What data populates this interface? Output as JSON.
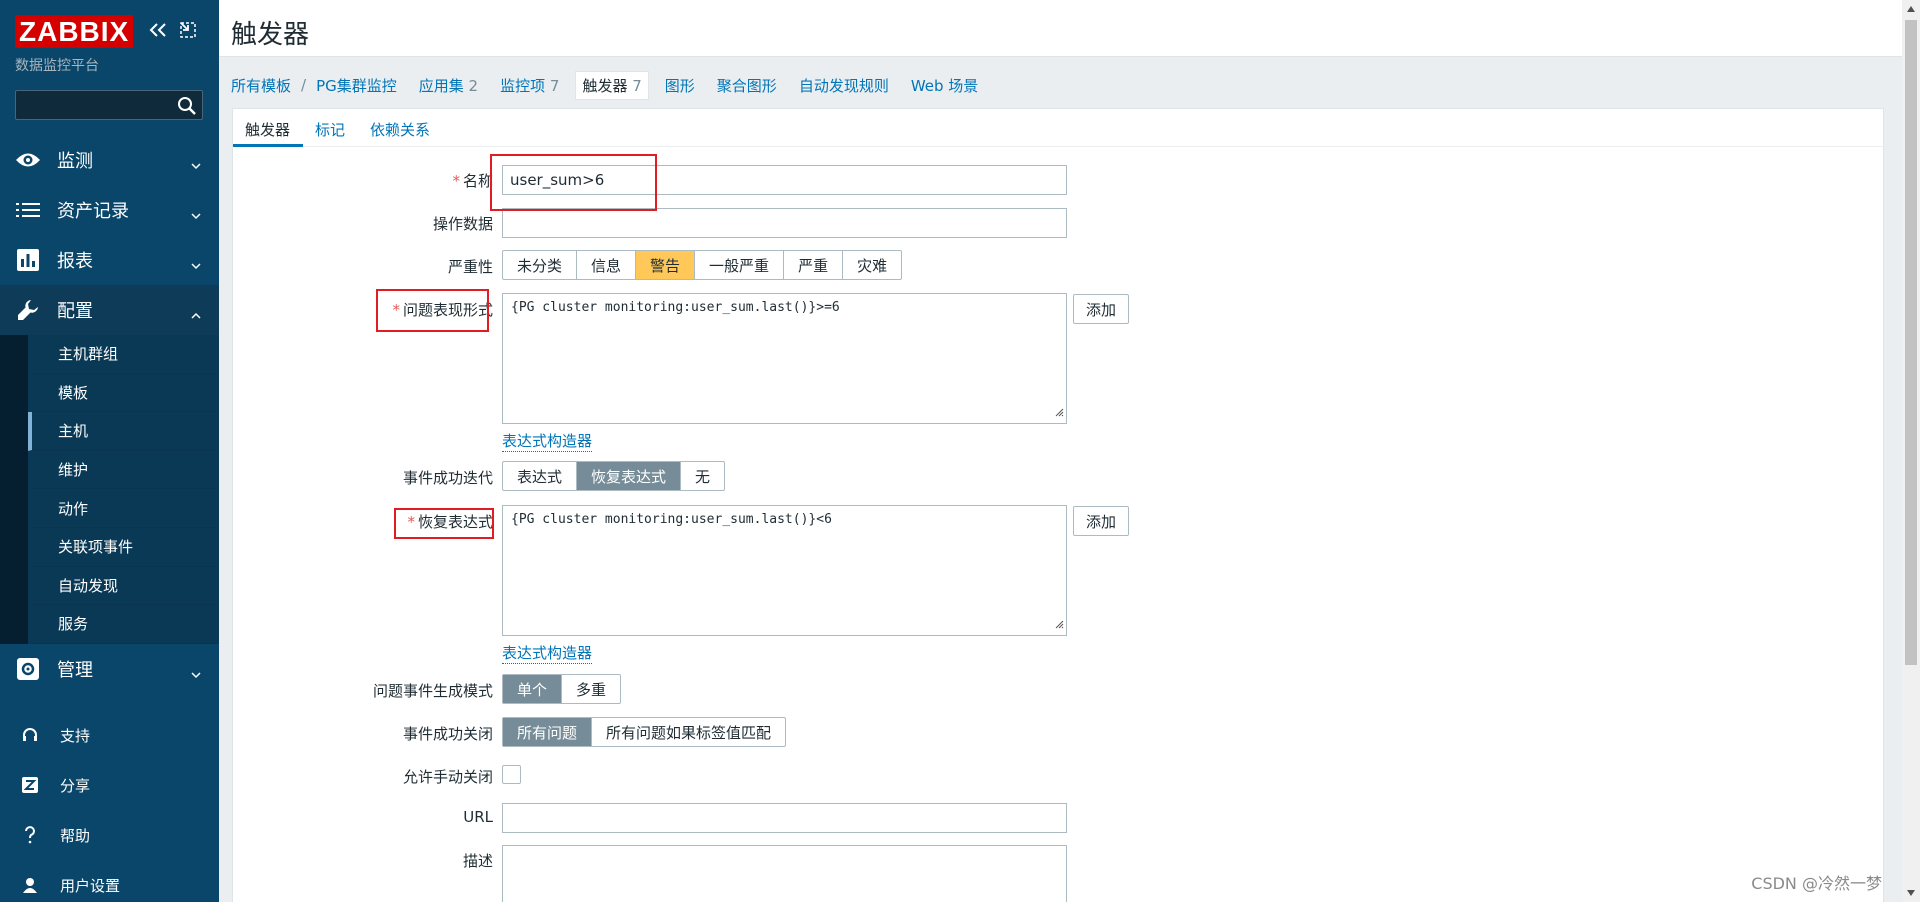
{
  "brand": {
    "logo": "ZABBIX",
    "subtitle": "数据监控平台"
  },
  "sidebar": {
    "search_placeholder": "",
    "menu": [
      {
        "label": "监测",
        "icon": "eye-icon"
      },
      {
        "label": "资产记录",
        "icon": "list-icon"
      },
      {
        "label": "报表",
        "icon": "bar-chart-icon"
      },
      {
        "label": "配置",
        "icon": "wrench-icon"
      }
    ],
    "config_submenu": [
      "主机群组",
      "模板",
      "主机",
      "维护",
      "动作",
      "关联项事件",
      "自动发现",
      "服务"
    ],
    "admin": {
      "label": "管理",
      "icon": "gear-icon"
    },
    "lower": [
      {
        "label": "支持",
        "icon": "headset-icon"
      },
      {
        "label": "分享",
        "icon": "share-icon"
      },
      {
        "label": "帮助",
        "icon": "help-icon"
      },
      {
        "label": "用户设置",
        "icon": "user-icon"
      }
    ]
  },
  "page": {
    "title": "触发器",
    "nav": {
      "all_templates": "所有模板",
      "separator": "/",
      "template": "PG集群监控",
      "applications": "应用集",
      "applications_count": "2",
      "items": "监控项",
      "items_count": "7",
      "triggers": "触发器",
      "triggers_count": "7",
      "graphs": "图形",
      "screens": "聚合图形",
      "discovery": "自动发现规则",
      "web": "Web 场景"
    },
    "tabs": [
      "触发器",
      "标记",
      "依赖关系"
    ]
  },
  "form": {
    "name_label": "名称",
    "name_value": "user_sum>6",
    "opdata_label": "操作数据",
    "opdata_value": "",
    "severity_label": "严重性",
    "severity_options": [
      "未分类",
      "信息",
      "警告",
      "一般严重",
      "严重",
      "灾难"
    ],
    "severity_selected": "警告",
    "expression_label": "问题表现形式",
    "expression_value": "{PG cluster monitoring:user_sum.last()}>=6",
    "add_label": "添加",
    "builder_link": "表达式构造器",
    "ok_event_label": "事件成功迭代",
    "ok_event_options": [
      "表达式",
      "恢复表达式",
      "无"
    ],
    "ok_event_selected": "恢复表达式",
    "recovery_label": "恢复表达式",
    "recovery_value": "{PG cluster monitoring:user_sum.last()}<6",
    "mode_label": "问题事件生成模式",
    "mode_options": [
      "单个",
      "多重"
    ],
    "mode_selected": "单个",
    "close_label": "事件成功关闭",
    "close_options": [
      "所有问题",
      "所有问题如果标签值匹配"
    ],
    "close_selected": "所有问题",
    "manual_close_label": "允许手动关闭",
    "url_label": "URL",
    "url_value": "",
    "desc_label": "描述"
  },
  "watermark": "CSDN @冷然一梦",
  "colors": {
    "sidebar": "#0a466a",
    "logo": "#d40000",
    "warning": "#ffc859",
    "link": "#0275b8",
    "annotation": "#e11d24"
  }
}
